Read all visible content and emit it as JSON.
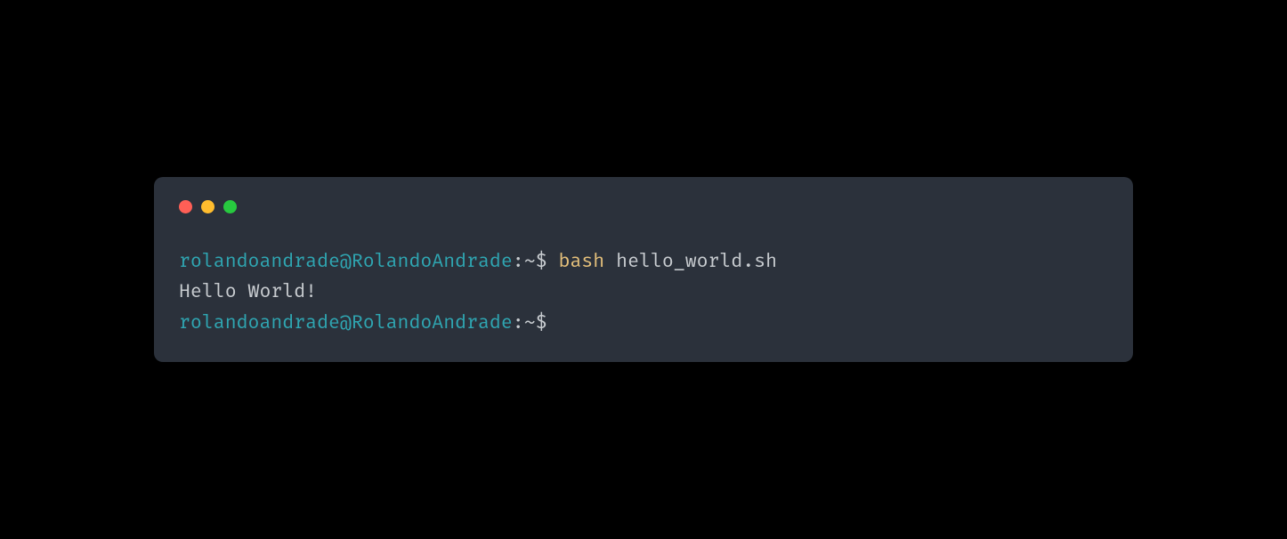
{
  "terminal": {
    "lines": [
      {
        "prompt_user": "rolandoandrade@RolandoAndrade",
        "prompt_colon": ":",
        "prompt_path": "~",
        "prompt_symbol": "$",
        "command_keyword": "bash",
        "command_arg": "hello_world.sh"
      },
      {
        "output": "Hello World!"
      },
      {
        "prompt_user": "rolandoandrade@RolandoAndrade",
        "prompt_colon": ":",
        "prompt_path": "~",
        "prompt_symbol": "$",
        "command_keyword": "",
        "command_arg": ""
      }
    ]
  },
  "colors": {
    "window_bg": "#2b313b",
    "close": "#ff5f56",
    "minimize": "#ffbd2e",
    "maximize": "#27c93f",
    "prompt_user": "#2fa6b2",
    "command_keyword": "#e5c07b",
    "text": "#c8ccd0"
  }
}
